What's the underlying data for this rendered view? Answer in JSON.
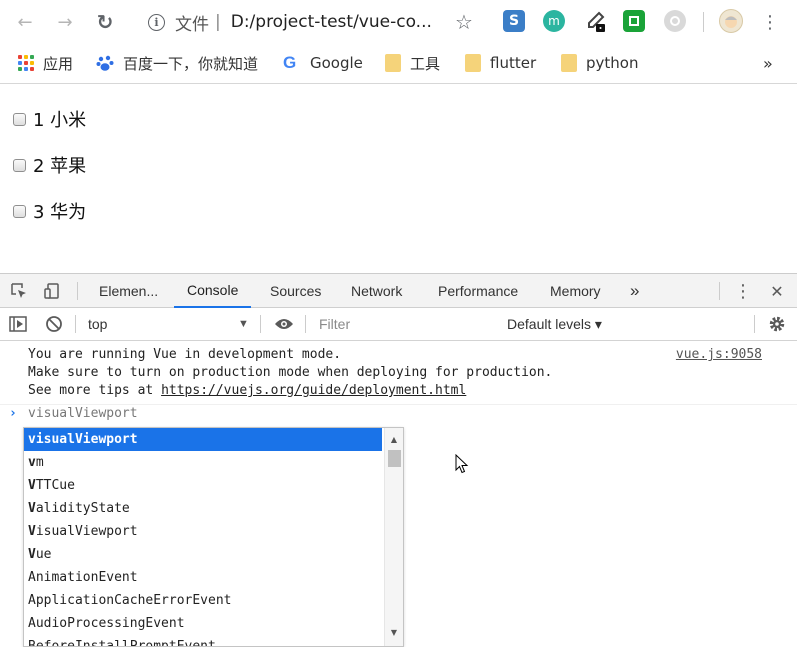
{
  "browser": {
    "nav": {
      "back": "←",
      "forward": "→",
      "reload": "↻"
    },
    "omnibox": {
      "label": "文件",
      "separator": "|",
      "url": "D:/project-test/vue-co..."
    },
    "star": "☆",
    "menu": "⋮",
    "ext_m": "m"
  },
  "bookmarks": {
    "items": [
      {
        "label": "应用"
      },
      {
        "label": "百度一下，你就知道"
      },
      {
        "label": "Google"
      },
      {
        "label": "工具"
      },
      {
        "label": "flutter"
      },
      {
        "label": "python"
      }
    ],
    "more": "»"
  },
  "page": {
    "items": [
      {
        "label": "1 小米"
      },
      {
        "label": "2 苹果"
      },
      {
        "label": "3 华为"
      }
    ]
  },
  "devtools": {
    "tabs": [
      {
        "label": "Elemen..."
      },
      {
        "label": "Console"
      },
      {
        "label": "Sources"
      },
      {
        "label": "Network"
      },
      {
        "label": "Performance"
      },
      {
        "label": "Memory"
      }
    ],
    "more_tabs": "»",
    "close": "✕",
    "menu": "⋮",
    "filterbar": {
      "context": "top",
      "filter_placeholder": "Filter",
      "levels": "Default levels ▾"
    }
  },
  "console": {
    "message_lines": [
      "You are running Vue in development mode.",
      "Make sure to turn on production mode when deploying for production.",
      "See more tips at "
    ],
    "message_link": "https://vuejs.org/guide/deployment.html",
    "source_link": "vue.js:9058",
    "prompt_input": "visualViewport",
    "suggestions": [
      {
        "bold": "visualViewport",
        "rest": ""
      },
      {
        "bold": "v",
        "rest": "m"
      },
      {
        "bold": "V",
        "rest": "TTCue"
      },
      {
        "bold": "V",
        "rest": "alidityState"
      },
      {
        "bold": "V",
        "rest": "isualViewport"
      },
      {
        "bold": "V",
        "rest": "ue"
      },
      {
        "bold": "",
        "rest": "AnimationEvent"
      },
      {
        "bold": "",
        "rest": "ApplicationCacheErrorEvent"
      },
      {
        "bold": "",
        "rest": "AudioProcessingEvent"
      },
      {
        "bold": "",
        "rest": "BeforeInstallPromptEvent"
      }
    ]
  },
  "colors": {
    "accent": "#1a73e8",
    "selection": "#1a73e8"
  }
}
